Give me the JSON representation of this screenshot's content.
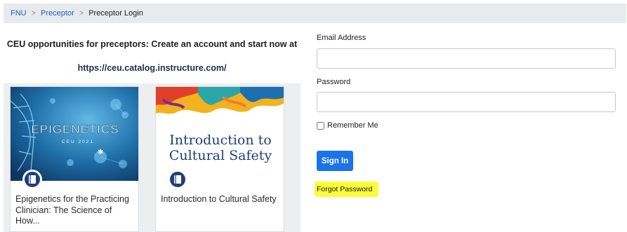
{
  "breadcrumb": {
    "items": [
      "FNU",
      "Preceptor"
    ],
    "current": "Preceptor Login",
    "separator": ">"
  },
  "promo": {
    "line1": "CEU opportunities for preceptors: Create an account and start now at",
    "line2": "https://ceu.catalog.instructure.com/"
  },
  "courses": [
    {
      "image_text_main": "EPIGENETICS",
      "image_text_sub": "CEU 2021",
      "title": "Epigenetics for the Practicing Clinician: The Science of How...",
      "icon": "course-book-icon"
    },
    {
      "image_text_main": "Introduction to Cultural Safety",
      "title": "Introduction to Cultural Safety",
      "icon": "course-book-icon"
    }
  ],
  "login": {
    "email_label": "Email Address",
    "email_value": "",
    "password_label": "Password",
    "password_value": "",
    "remember_label": "Remember Me",
    "remember_checked": false,
    "signin_label": "Sign In",
    "forgot_label": "Forgot Password"
  },
  "colors": {
    "link": "#1a63c6",
    "primary_button": "#1a73e8",
    "highlight": "#fbfb3c",
    "badge": "#1f3f78"
  }
}
